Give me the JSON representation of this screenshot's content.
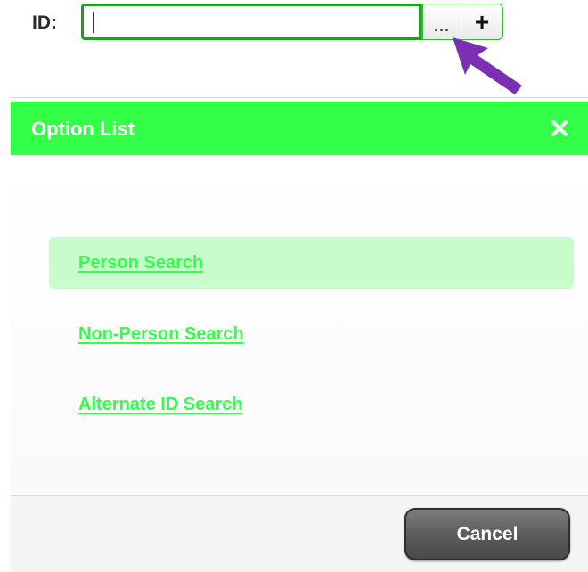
{
  "id_field": {
    "label": "ID:",
    "value": "",
    "ellipsis_label": "...",
    "add_label": "+"
  },
  "annotation": {
    "arrow_color": "#7b2fb5"
  },
  "dialog": {
    "title": "Option List",
    "close_icon": "close-icon",
    "header_color": "#33ff49",
    "options": [
      {
        "label": "Person Search",
        "selected": true
      },
      {
        "label": "Non-Person Search",
        "selected": false
      },
      {
        "label": "Alternate ID Search",
        "selected": false
      }
    ],
    "cancel_label": "Cancel"
  }
}
